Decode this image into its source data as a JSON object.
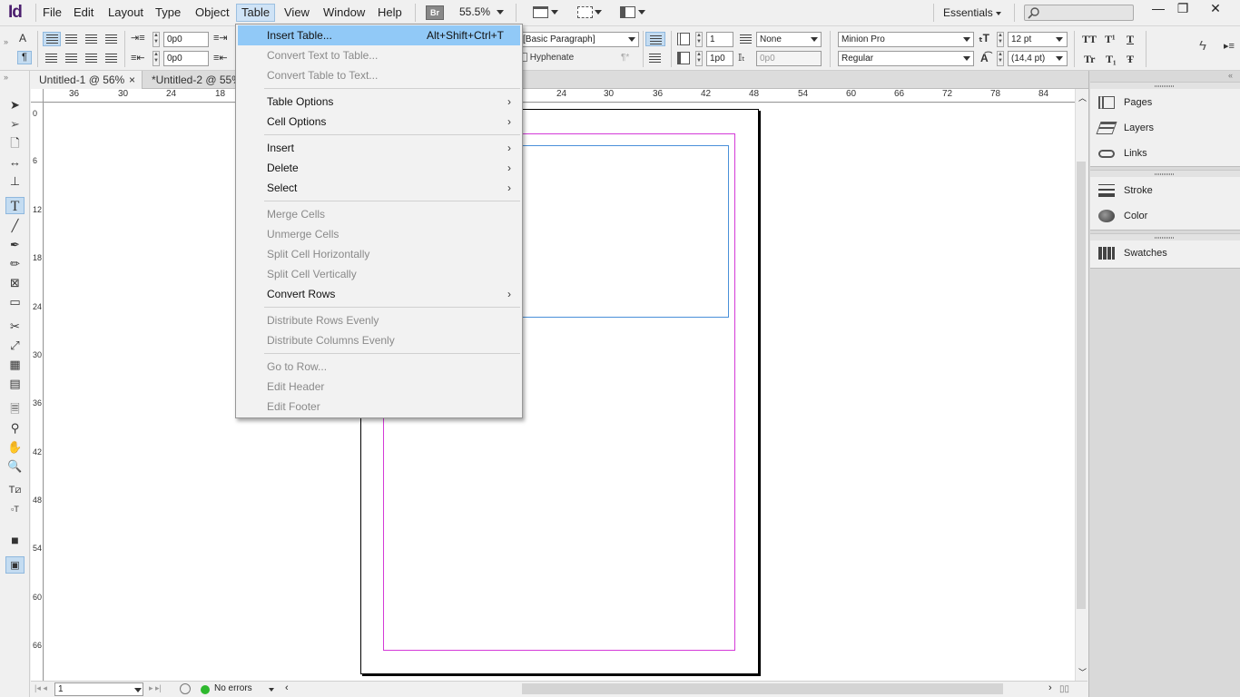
{
  "app": {
    "logo": "Id"
  },
  "menubar": {
    "items": [
      "File",
      "Edit",
      "Layout",
      "Type",
      "Object",
      "Table",
      "View",
      "Window",
      "Help"
    ],
    "bridge": "Br",
    "zoom": "55.5%",
    "workspace": "Essentials",
    "window_controls": {
      "minimize": "—",
      "restore": "❐",
      "close": "✕"
    }
  },
  "control": {
    "indent_left": "0p0",
    "indent_first": "0p0",
    "paragraph_style": "[Basic Paragraph]",
    "hyphenate": "Hyphenate",
    "columns": "1",
    "gutter": "1p0",
    "none_label": "None",
    "grid_value": "0p0",
    "font_family": "Minion Pro",
    "font_style": "Regular",
    "font_size": "12 pt",
    "leading": "(14,4 pt)",
    "char_buttons": {
      "tt": "TT",
      "tsup": "T¹",
      "tu": "T",
      "tr": "Tr",
      "tsub": "T₁",
      "tstrike": "Ŧ"
    },
    "para_mark": "¶"
  },
  "tabs": [
    {
      "label": "Untitled-1 @ 56%",
      "close": "×"
    },
    {
      "label": "*Untitled-2 @ 55%",
      "close": ""
    }
  ],
  "ruler": {
    "h": [
      "36",
      "30",
      "24",
      "18",
      "24",
      "30",
      "36",
      "42",
      "48",
      "54",
      "60",
      "66",
      "72",
      "78",
      "84"
    ],
    "v": [
      "0",
      "6",
      "12",
      "18",
      "24",
      "30",
      "36",
      "42",
      "48",
      "54",
      "60",
      "66"
    ]
  },
  "status": {
    "page": "1",
    "errors": "No errors"
  },
  "panels": {
    "group1": [
      "Pages",
      "Layers",
      "Links"
    ],
    "group2": [
      "Stroke",
      "Color"
    ],
    "group3": [
      "Swatches"
    ]
  },
  "table_menu": {
    "insert_table": {
      "label": "Insert Table...",
      "shortcut": "Alt+Shift+Ctrl+T"
    },
    "convert_text": "Convert Text to Table...",
    "convert_table": "Convert Table to Text...",
    "table_options": "Table Options",
    "cell_options": "Cell Options",
    "insert": "Insert",
    "delete": "Delete",
    "select": "Select",
    "merge": "Merge Cells",
    "unmerge": "Unmerge Cells",
    "split_h": "Split Cell Horizontally",
    "split_v": "Split Cell Vertically",
    "convert_rows": "Convert Rows",
    "dist_rows": "Distribute Rows Evenly",
    "dist_cols": "Distribute Columns Evenly",
    "go_to_row": "Go to Row...",
    "edit_header": "Edit Header",
    "edit_footer": "Edit Footer",
    "submenu_arrow": "›"
  },
  "colors": {
    "accent": "#91c9f7",
    "margin_guide": "#d43ad8",
    "frame": "#4a90d9",
    "status_ok": "#2eb82e"
  }
}
